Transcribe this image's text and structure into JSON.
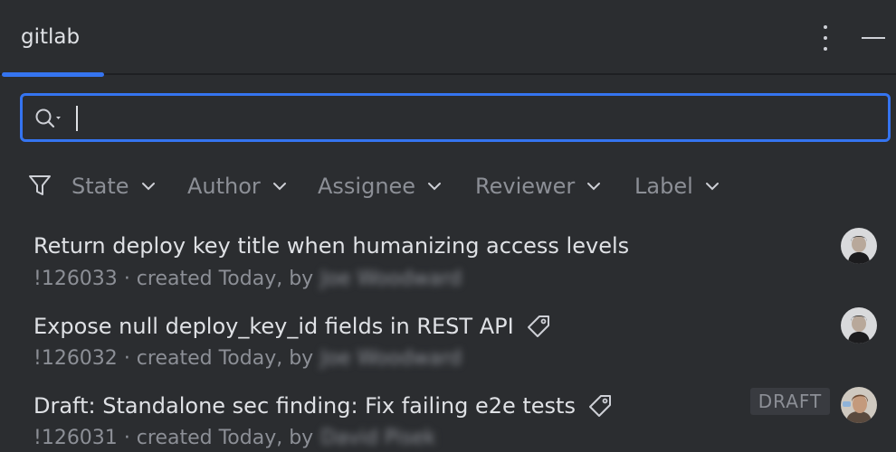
{
  "header": {
    "tab_label": "gitlab"
  },
  "search": {
    "value": "",
    "placeholder": ""
  },
  "filters": [
    {
      "label": "State"
    },
    {
      "label": "Author"
    },
    {
      "label": "Assignee"
    },
    {
      "label": "Reviewer"
    },
    {
      "label": "Label"
    }
  ],
  "merge_requests": [
    {
      "title": "Return deploy key title when humanizing access levels",
      "id": "!126033",
      "meta_mid": "· created Today, by",
      "author": "Joe Woodward",
      "has_label_icon": false,
      "draft": false
    },
    {
      "title": "Expose null deploy_key_id fields in REST API",
      "id": "!126032",
      "meta_mid": "· created Today, by",
      "author": "Joe Woodward",
      "has_label_icon": true,
      "draft": false
    },
    {
      "title": "Draft: Standalone sec finding: Fix failing e2e tests",
      "id": "!126031",
      "meta_mid": "· created Today, by",
      "author": "David Pisek",
      "has_label_icon": true,
      "draft": true,
      "draft_label": "DRAFT"
    }
  ],
  "colors": {
    "background": "#2b2d30",
    "accent": "#3574f0",
    "text_primary": "#dfe1e5",
    "text_secondary": "#8c8f96"
  }
}
